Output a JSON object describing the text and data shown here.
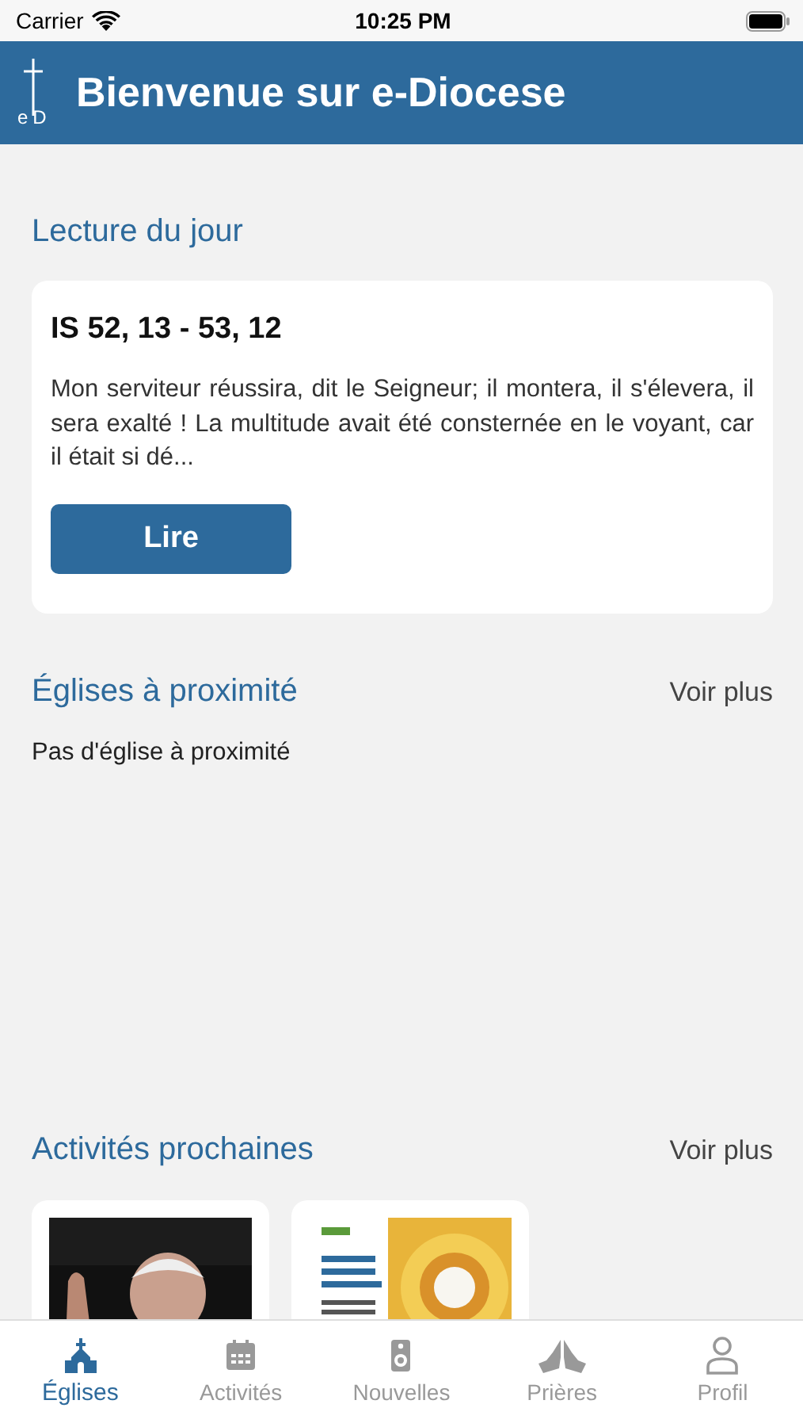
{
  "status_bar": {
    "carrier": "Carrier",
    "time": "10:25 PM"
  },
  "header": {
    "logo": "eD",
    "title": "Bienvenue sur e-Diocese"
  },
  "reading": {
    "heading": "Lecture du jour",
    "reference": "IS 52, 13 - 53, 12",
    "excerpt": "Mon serviteur réussira, dit le Seigneur; il montera, il s'élevera, il sera exalté ! La multitude avait été consternée en le voyant, car il était si dé...",
    "button": "Lire"
  },
  "churches": {
    "heading": "Églises à proximité",
    "more": "Voir plus",
    "empty": "Pas d'église à proximité"
  },
  "activities": {
    "heading": "Activités prochaines",
    "more": "Voir plus"
  },
  "tabs": [
    {
      "label": "Églises",
      "selected": true
    },
    {
      "label": "Activités",
      "selected": false
    },
    {
      "label": "Nouvelles",
      "selected": false
    },
    {
      "label": "Prières",
      "selected": false
    },
    {
      "label": "Profil",
      "selected": false
    }
  ]
}
